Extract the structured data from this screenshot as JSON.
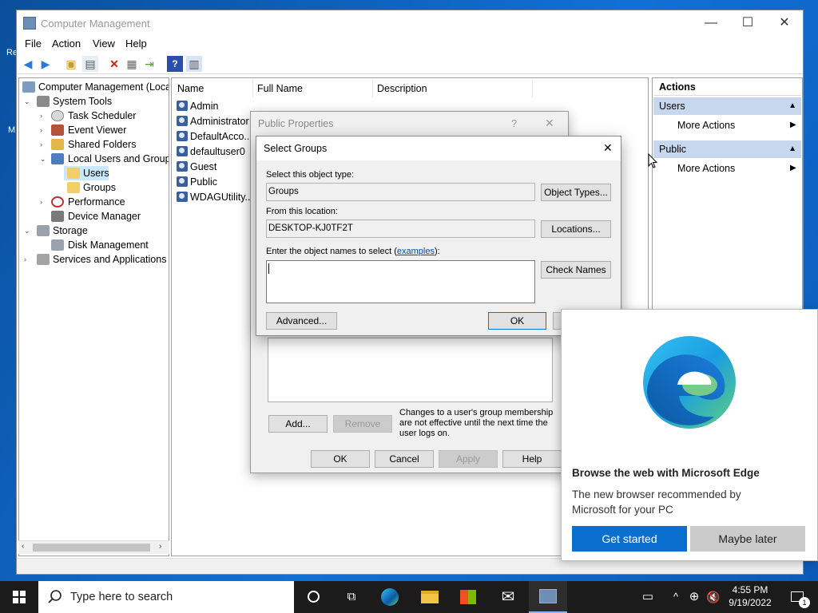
{
  "desktop": {
    "label_re": "Re",
    "label_m": "M"
  },
  "window": {
    "title": "Computer Management",
    "min": "—",
    "max": "☐",
    "close": "✕"
  },
  "menu": [
    "File",
    "Action",
    "View",
    "Help"
  ],
  "tree": {
    "root": "Computer Management (Local",
    "system_tools": "System Tools",
    "task_scheduler": "Task Scheduler",
    "event_viewer": "Event Viewer",
    "shared_folders": "Shared Folders",
    "local_users": "Local Users and Groups",
    "users": "Users",
    "groups": "Groups",
    "performance": "Performance",
    "device_manager": "Device Manager",
    "storage": "Storage",
    "disk_management": "Disk Management",
    "services": "Services and Applications"
  },
  "list": {
    "headers": [
      "Name",
      "Full Name",
      "Description"
    ],
    "rows": [
      "Admin",
      "Administrator",
      "DefaultAcco...",
      "defaultuser0",
      "Guest",
      "Public",
      "WDAGUtility..."
    ]
  },
  "actions": {
    "title": "Actions",
    "section1": "Users",
    "more1": "More Actions",
    "section2": "Public",
    "more2": "More Actions"
  },
  "props": {
    "title": "Public Properties",
    "help": "?",
    "close": "✕",
    "add": "Add...",
    "remove": "Remove",
    "note": "Changes to a user's group membership are not effective until the next time the user logs on.",
    "ok": "OK",
    "cancel": "Cancel",
    "apply": "Apply",
    "help_btn": "Help"
  },
  "select_groups": {
    "title": "Select Groups",
    "close": "✕",
    "object_type_label": "Select this object type:",
    "object_type_value": "Groups",
    "object_types_btn": "Object Types...",
    "location_label": "From this location:",
    "location_value": "DESKTOP-KJ0TF2T",
    "locations_btn": "Locations...",
    "names_label_prefix": "Enter the object names to select (",
    "names_link": "examples",
    "names_label_suffix": "):",
    "names_value": "",
    "check_names_btn": "Check Names",
    "advanced_btn": "Advanced...",
    "ok_btn": "OK"
  },
  "edge": {
    "heading": "Browse the web with Microsoft Edge",
    "body": "The new browser recommended by Microsoft for your PC",
    "get_started": "Get started",
    "maybe_later": "Maybe later"
  },
  "taskbar": {
    "search_placeholder": "Type here to search",
    "time": "4:55 PM",
    "date": "9/19/2022",
    "notification_count": "1"
  },
  "colors": {
    "accent": "#0078d4",
    "selection": "#cce8ff",
    "action_header": "#c7d7ee",
    "edge_primary": "#0b6fd0"
  }
}
